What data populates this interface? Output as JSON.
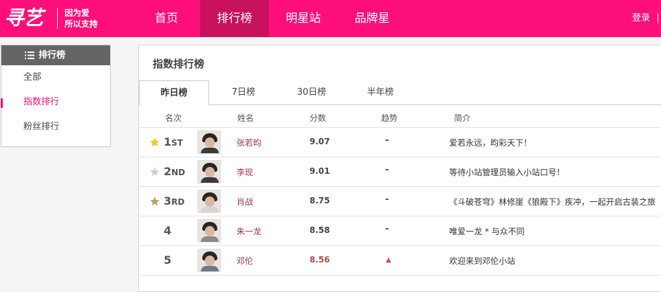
{
  "logo": {
    "main": "寻艺",
    "slogan_line1": "因为爱",
    "slogan_line2": "所以支持"
  },
  "nav": {
    "items": [
      "首页",
      "排行榜",
      "明星站",
      "品牌星"
    ],
    "active_index": 1
  },
  "header": {
    "login": "登录"
  },
  "sidebar": {
    "title": "排行榜",
    "items": [
      "全部",
      "指数排行",
      "粉丝排行"
    ],
    "active_index": 1
  },
  "panel": {
    "title": "指数排行榜",
    "tabs": [
      "昨日榜",
      "7日榜",
      "30日榜",
      "半年榜"
    ],
    "active_tab": 0
  },
  "table": {
    "columns": [
      "名次",
      "姓名",
      "分数",
      "趋势",
      "简介"
    ],
    "rows": [
      {
        "rank": "1",
        "rank_suffix": "ST",
        "star": "gold",
        "name": "张若昀",
        "score": "9.07",
        "trend": "-",
        "intro": "爱若永远，昀彩天下！"
      },
      {
        "rank": "2",
        "rank_suffix": "ND",
        "star": "silver",
        "name": "李现",
        "score": "9.01",
        "trend": "-",
        "intro": "等待小站管理员输入小站口号！"
      },
      {
        "rank": "3",
        "rank_suffix": "RD",
        "star": "bronze",
        "name": "肖战",
        "score": "8.75",
        "trend": "-",
        "intro": "《斗破苍穹》林修崖《狼殿下》疾冲，一起开启古装之旅"
      },
      {
        "rank": "4",
        "rank_suffix": "",
        "star": "none",
        "name": "朱一龙",
        "score": "8.58",
        "trend": "-",
        "intro": "唯爱一龙 * 与众不同"
      },
      {
        "rank": "5",
        "rank_suffix": "",
        "star": "none",
        "name": "邓伦",
        "score": "8.56",
        "trend": "▲",
        "intro": "欢迎来到邓伦小站"
      }
    ]
  },
  "colors": {
    "brand": "#ff0f7a",
    "nav_active": "#c9125e",
    "accent": "#e8116f",
    "star_gold": "#f5c518",
    "star_silver": "#cfcfcf",
    "star_bronze": "#b5a55f"
  }
}
